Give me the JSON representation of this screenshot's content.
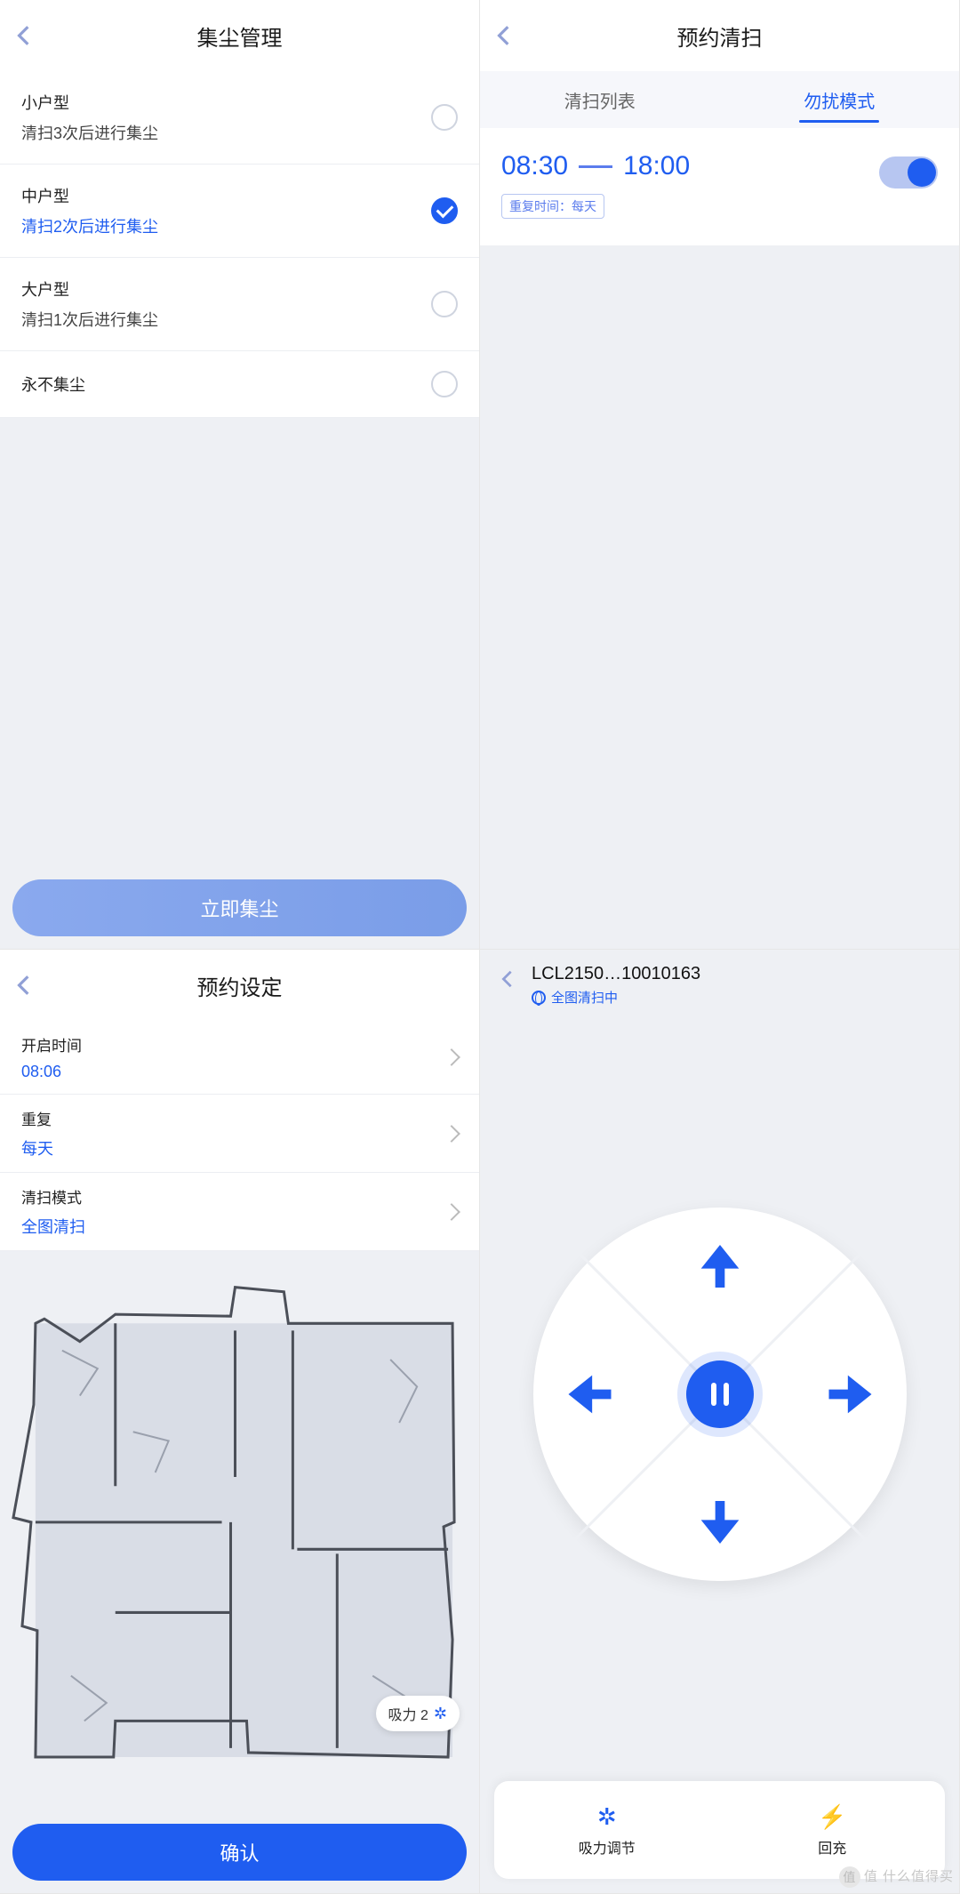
{
  "paneA": {
    "title": "集尘管理",
    "options": [
      {
        "title": "小户型",
        "sub": "清扫3次后进行集尘",
        "selected": false
      },
      {
        "title": "中户型",
        "sub": "清扫2次后进行集尘",
        "selected": true
      },
      {
        "title": "大户型",
        "sub": "清扫1次后进行集尘",
        "selected": false
      },
      {
        "title": "永不集尘",
        "sub": "",
        "selected": false
      }
    ],
    "button": "立即集尘"
  },
  "paneB": {
    "title": "预约清扫",
    "tabs": [
      "清扫列表",
      "勿扰模式"
    ],
    "activeTab": 1,
    "dnd": {
      "start": "08:30",
      "end": "18:00",
      "repeatLabel": "重复时间：每天",
      "enabled": true
    }
  },
  "paneC": {
    "title": "预约设定",
    "rows": [
      {
        "label": "开启时间",
        "value": "08:06"
      },
      {
        "label": "重复",
        "value": "每天"
      },
      {
        "label": "清扫模式",
        "value": "全图清扫"
      }
    ],
    "suctionChip": {
      "label": "吸力 2"
    },
    "confirm": "确认"
  },
  "paneD": {
    "deviceName": "LCL2150…10010163",
    "status": "全图清扫中",
    "bottom": [
      {
        "icon": "fan",
        "label": "吸力调节"
      },
      {
        "icon": "charge",
        "label": "回充"
      }
    ]
  },
  "watermark": "值 什么值得买"
}
